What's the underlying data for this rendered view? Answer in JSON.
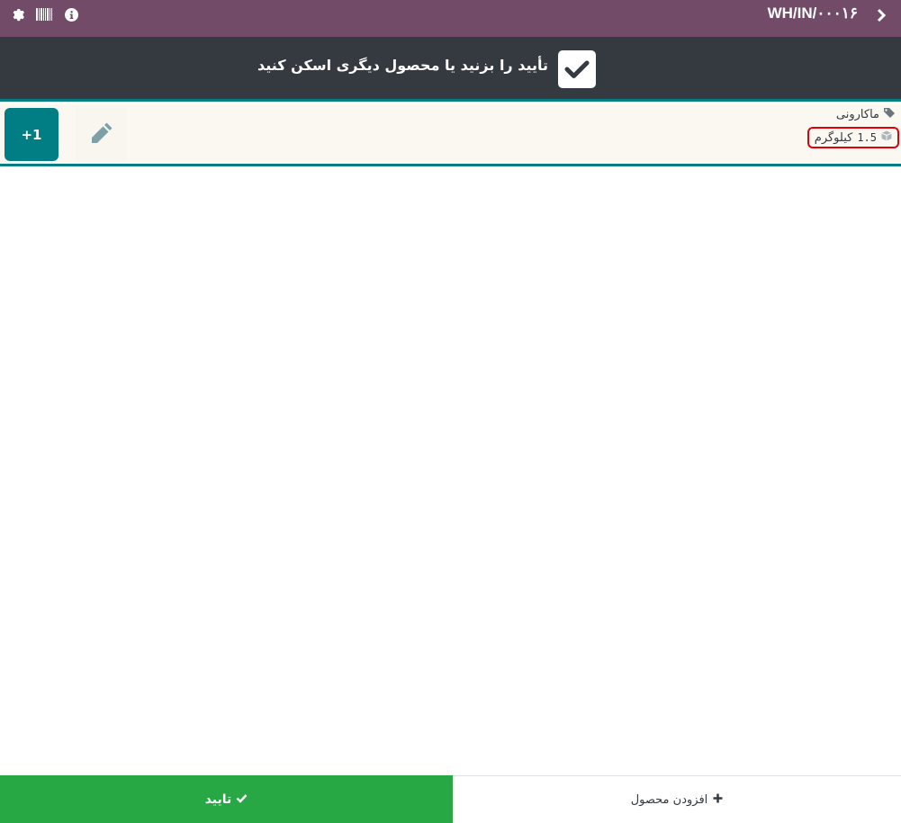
{
  "header": {
    "title": "WH/IN/۰۰۰۱۶",
    "icons": [
      "gear-icon",
      "barcode-icon",
      "info-icon",
      "chevron-right-icon"
    ],
    "bg_color": "#714b67"
  },
  "banner": {
    "message": "تأیید را بزنید یا محصول دیگری اسکن کنید",
    "icon": "checkmark-icon"
  },
  "line": {
    "increment_label": "+1",
    "product_name": "ماکارونی",
    "quantity": "1.5",
    "uom": "کیلوگرم",
    "accent_color": "#017e84"
  },
  "footer": {
    "confirm_label": "تایید",
    "add_product_label": "افزودن محصول",
    "confirm_color": "#28a745"
  }
}
